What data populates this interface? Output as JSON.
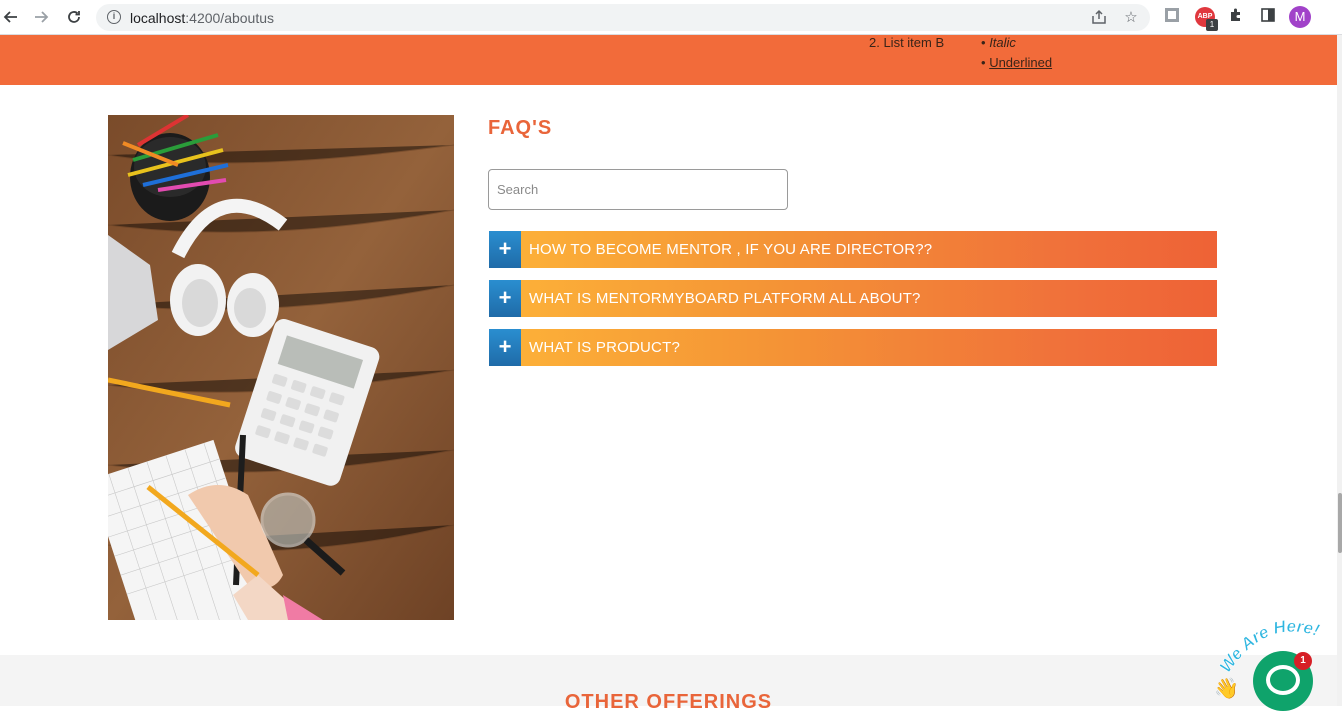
{
  "browser": {
    "url_host": "localhost",
    "url_path": ":4200/aboutus",
    "profile_initial": "M",
    "abp_label": "ABP",
    "abp_badge": "1"
  },
  "banner": {
    "list_item": "2. List item B",
    "italic_bullet": "•",
    "italic_text": "Italic",
    "underline_bullet": "•",
    "underline_text": "Underlined"
  },
  "faq": {
    "title": "FAQ'S",
    "search_placeholder": "Search",
    "items": [
      {
        "icon": "+",
        "question": "HOW TO BECOME MENTOR , IF YOU ARE DIRECTOR??"
      },
      {
        "icon": "+",
        "question": "WHAT IS MENTORMYBOARD PLATFORM ALL ABOUT?"
      },
      {
        "icon": "+",
        "question": "WHAT IS PRODUCT?"
      }
    ]
  },
  "offerings": {
    "title": "OTHER OFFERINGS"
  },
  "chat": {
    "tagline": "We Are Here!",
    "badge": "1"
  },
  "colors": {
    "accent": "#f26b3a",
    "heading": "#e9653a",
    "faq_icon": "#1f6ba8",
    "chat": "#0fa36b"
  }
}
